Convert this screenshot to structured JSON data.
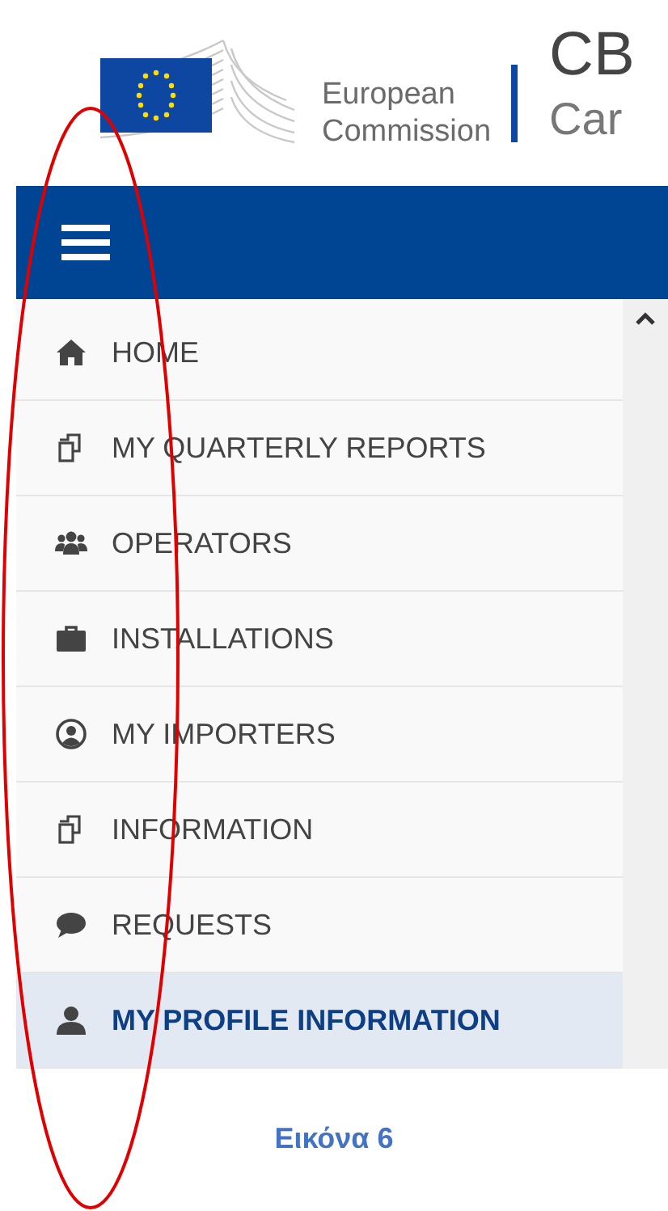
{
  "header": {
    "org_name_line_1": "European",
    "org_name_line_2": "Commission",
    "title": "CB",
    "subtitle": "Car"
  },
  "sidebar": {
    "items": [
      {
        "label": "HOME",
        "kind": "home",
        "selected": false
      },
      {
        "label": "MY QUARTERLY REPORTS",
        "kind": "reports",
        "selected": false
      },
      {
        "label": "OPERATORS",
        "kind": "operators",
        "selected": false
      },
      {
        "label": "INSTALLATIONS",
        "kind": "installations",
        "selected": false
      },
      {
        "label": "MY IMPORTERS",
        "kind": "importers",
        "selected": false
      },
      {
        "label": "INFORMATION",
        "kind": "reports",
        "selected": false
      },
      {
        "label": "REQUESTS",
        "kind": "requests",
        "selected": false
      },
      {
        "label": "MY PROFILE INFORMATION",
        "kind": "profile",
        "selected": true
      }
    ]
  },
  "caption": "Εικόνα 6"
}
